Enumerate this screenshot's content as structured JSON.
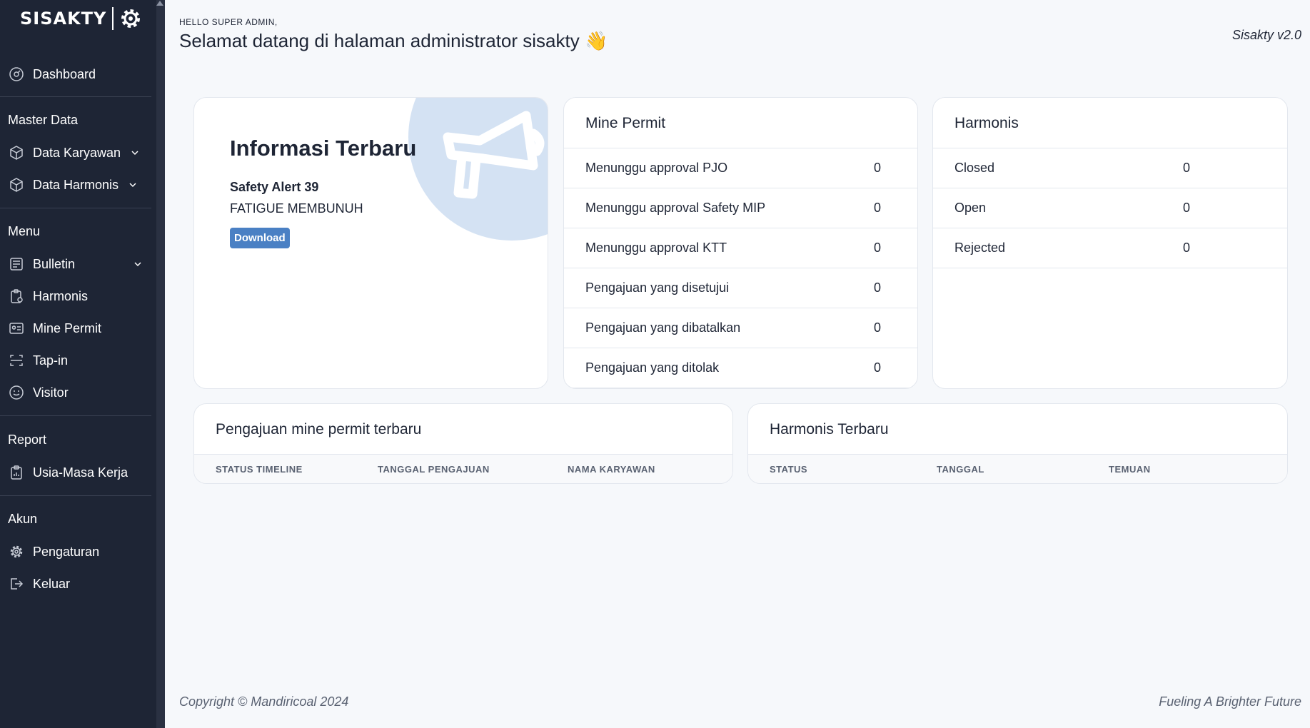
{
  "app": {
    "logo_text": "SISAKTY"
  },
  "sidebar": {
    "dashboard": "Dashboard",
    "master_data": {
      "title": "Master Data",
      "items": [
        "Data Karyawan",
        "Data Harmonis"
      ]
    },
    "menu": {
      "title": "Menu",
      "items": [
        "Bulletin",
        "Harmonis",
        "Mine Permit",
        "Tap-in",
        "Visitor"
      ]
    },
    "report": {
      "title": "Report",
      "items": [
        "Usia-Masa Kerja"
      ]
    },
    "akun": {
      "title": "Akun",
      "items": [
        "Pengaturan",
        "Keluar"
      ]
    }
  },
  "header": {
    "hello": "HELLO SUPER ADMIN,",
    "welcome": "Selamat datang di halaman administrator sisakty 👋",
    "version": "Sisakty v2.0"
  },
  "info": {
    "title": "Informasi Terbaru",
    "subtitle": "Safety Alert 39",
    "description": "FATIGUE MEMBUNUH",
    "button": "Download"
  },
  "mine_permit": {
    "title": "Mine Permit",
    "rows": [
      {
        "label": "Menunggu approval PJO",
        "value": "0"
      },
      {
        "label": "Menunggu approval Safety MIP",
        "value": "0"
      },
      {
        "label": "Menunggu approval KTT",
        "value": "0"
      },
      {
        "label": "Pengajuan yang disetujui",
        "value": "0"
      },
      {
        "label": "Pengajuan yang dibatalkan",
        "value": "0"
      },
      {
        "label": "Pengajuan yang ditolak",
        "value": "0"
      }
    ]
  },
  "harmonis": {
    "title": "Harmonis",
    "rows": [
      {
        "label": "Closed",
        "value": "0"
      },
      {
        "label": "Open",
        "value": "0"
      },
      {
        "label": "Rejected",
        "value": "0"
      }
    ]
  },
  "latest_mine_permit": {
    "title": "Pengajuan mine permit terbaru",
    "columns": [
      "STATUS TIMELINE",
      "TANGGAL PENGAJUAN",
      "NAMA KARYAWAN"
    ]
  },
  "latest_harmonis": {
    "title": "Harmonis Terbaru",
    "columns": [
      "STATUS",
      "TANGGAL",
      "TEMUAN"
    ]
  },
  "footer": {
    "copyright": "Copyright © Mandiricoal 2024",
    "tagline": "Fueling A Brighter Future"
  },
  "colors": {
    "sidebar_bg": "#1e2535",
    "accent": "#4a80c4",
    "circle": "#d4e2f3"
  }
}
